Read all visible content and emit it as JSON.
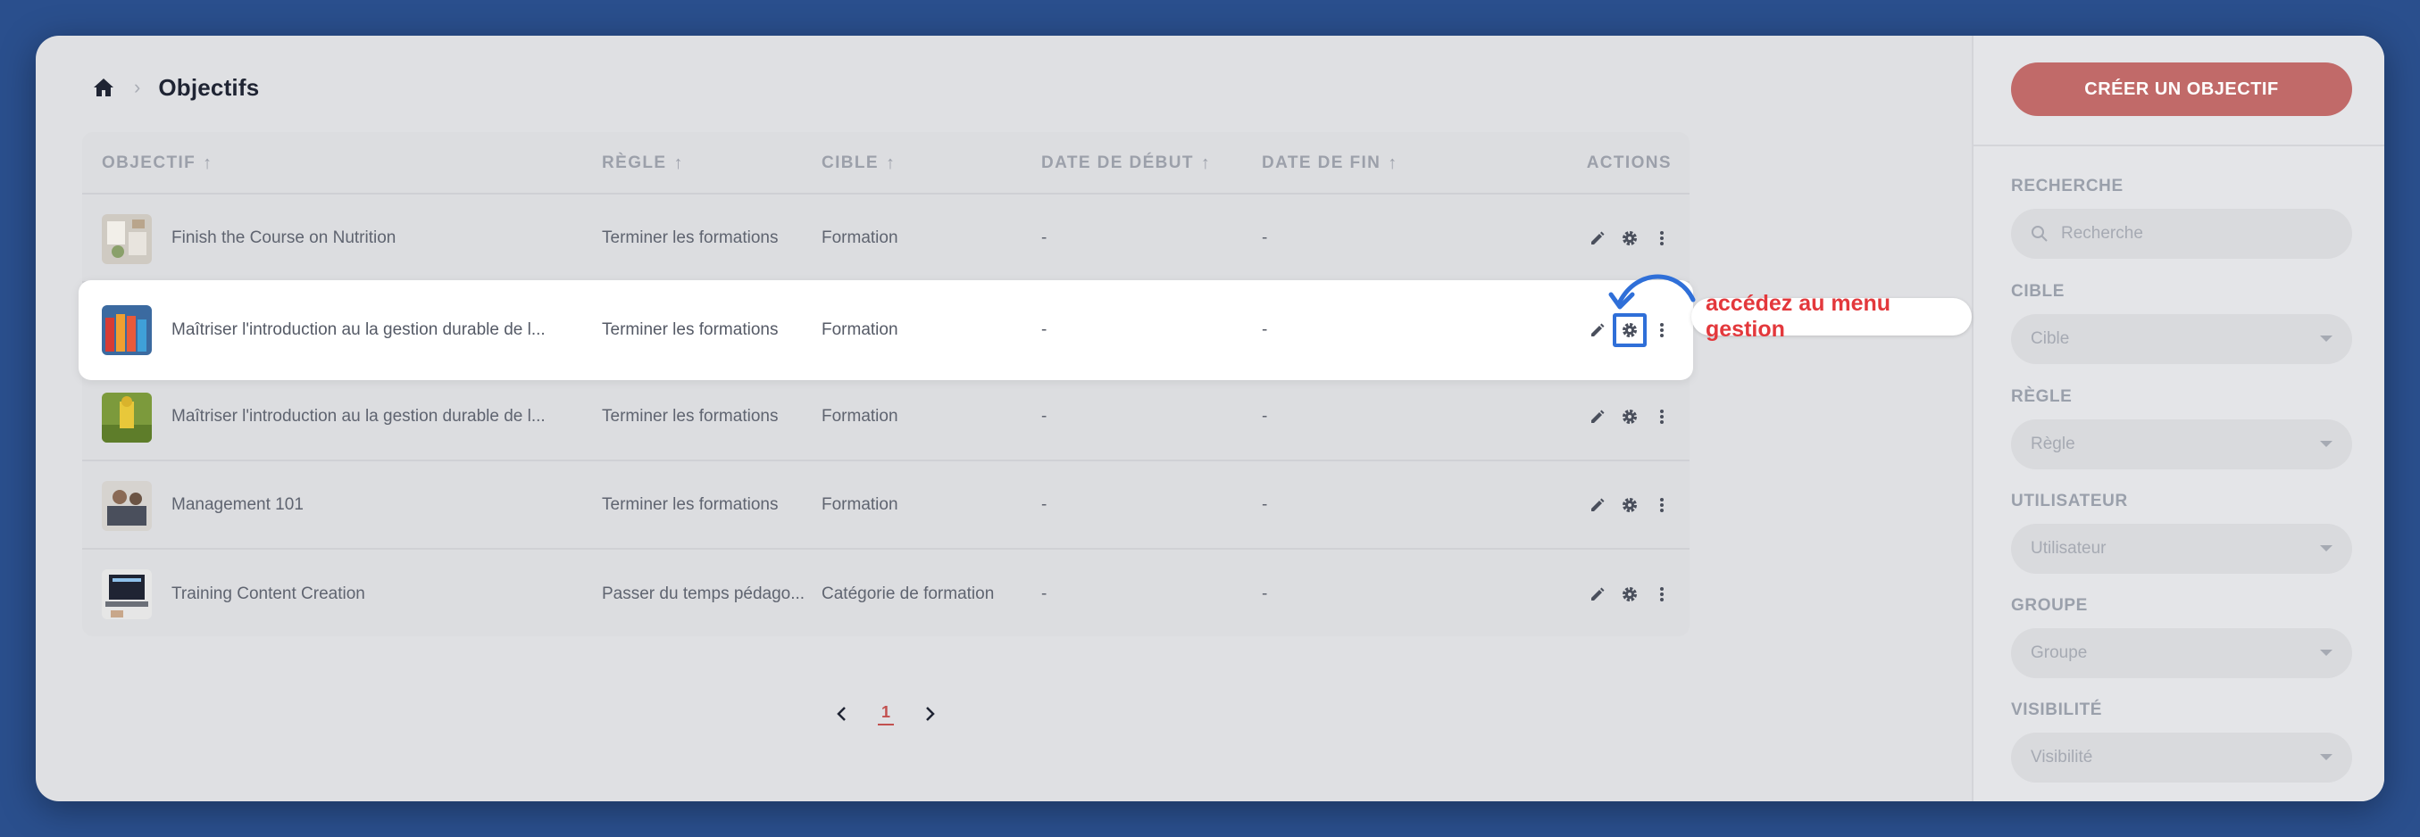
{
  "breadcrumb": {
    "title": "Objectifs"
  },
  "table": {
    "headers": {
      "objectif": "OBJECTIF",
      "regle": "RÈGLE",
      "cible": "CIBLE",
      "date_debut": "DATE DE DÉBUT",
      "date_fin": "DATE DE FIN",
      "actions": "ACTIONS"
    },
    "sort_arrow": "↑",
    "rows": [
      {
        "objectif": "Finish the Course on Nutrition",
        "regle": "Terminer les formations",
        "cible": "Formation",
        "date_debut": "-",
        "date_fin": "-"
      },
      {
        "objectif": "Maîtriser l'introduction au la gestion durable de l...",
        "regle": "Terminer les formations",
        "cible": "Formation",
        "date_debut": "-",
        "date_fin": "-"
      },
      {
        "objectif": "Maîtriser l'introduction au la gestion durable de l...",
        "regle": "Terminer les formations",
        "cible": "Formation",
        "date_debut": "-",
        "date_fin": "-"
      },
      {
        "objectif": "Management 101",
        "regle": "Terminer les formations",
        "cible": "Formation",
        "date_debut": "-",
        "date_fin": "-"
      },
      {
        "objectif": "Training Content Creation",
        "regle": "Passer du temps pédago...",
        "cible": "Catégorie de formation",
        "date_debut": "-",
        "date_fin": "-"
      }
    ]
  },
  "pagination": {
    "current": "1"
  },
  "callout": {
    "text": "accédez au menu gestion"
  },
  "sidebar": {
    "create_label": "CRÉER UN OBJECTIF",
    "filters": {
      "recherche": {
        "label": "RECHERCHE",
        "placeholder": "Recherche"
      },
      "cible": {
        "label": "CIBLE",
        "placeholder": "Cible"
      },
      "regle": {
        "label": "RÈGLE",
        "placeholder": "Règle"
      },
      "utilisateur": {
        "label": "UTILISATEUR",
        "placeholder": "Utilisateur"
      },
      "groupe": {
        "label": "GROUPE",
        "placeholder": "Groupe"
      },
      "visibilite": {
        "label": "VISIBILITÉ",
        "placeholder": "Visibilité"
      }
    }
  },
  "colors": {
    "accent": "#c16a69",
    "highlight_border": "#2f6fd8",
    "callout_text": "#e3383c",
    "background": "#2a4f8d"
  }
}
